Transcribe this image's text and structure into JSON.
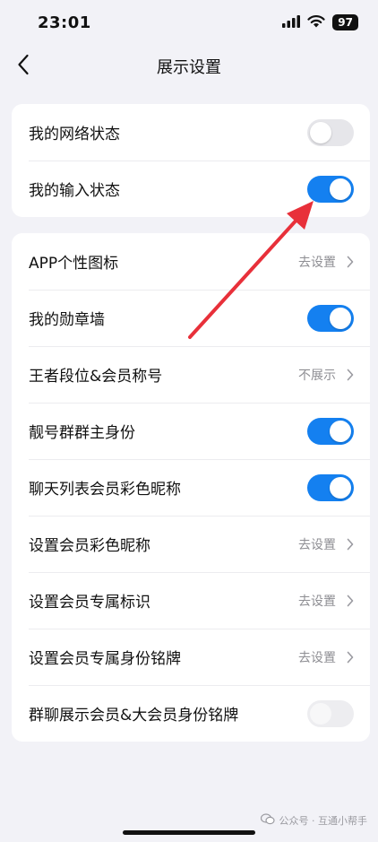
{
  "status_bar": {
    "time": "23:01",
    "battery": "97"
  },
  "nav": {
    "title": "展示设置",
    "back_icon": "chevron-left-icon"
  },
  "colors": {
    "accent": "#1480f0",
    "arrow": "#e8303a",
    "background": "#f2f2f7"
  },
  "group1": {
    "items": [
      {
        "label": "我的网络状态",
        "toggle": "off"
      },
      {
        "label": "我的输入状态",
        "toggle": "on"
      }
    ]
  },
  "group2": {
    "items": [
      {
        "label": "APP个性图标",
        "value": "去设置"
      },
      {
        "label": "我的勋章墙",
        "toggle": "on"
      },
      {
        "label": "王者段位&会员称号",
        "value": "不展示"
      },
      {
        "label": "靓号群群主身份",
        "toggle": "on"
      },
      {
        "label": "聊天列表会员彩色昵称",
        "toggle": "on"
      },
      {
        "label": "设置会员彩色昵称",
        "value": "去设置"
      },
      {
        "label": "设置会员专属标识",
        "value": "去设置"
      },
      {
        "label": "设置会员专属身份铭牌",
        "value": "去设置"
      },
      {
        "label": "群聊展示会员&大会员身份铭牌",
        "toggle": "disabled"
      }
    ]
  },
  "watermark": {
    "text": "公众号 · 互通小帮手"
  }
}
